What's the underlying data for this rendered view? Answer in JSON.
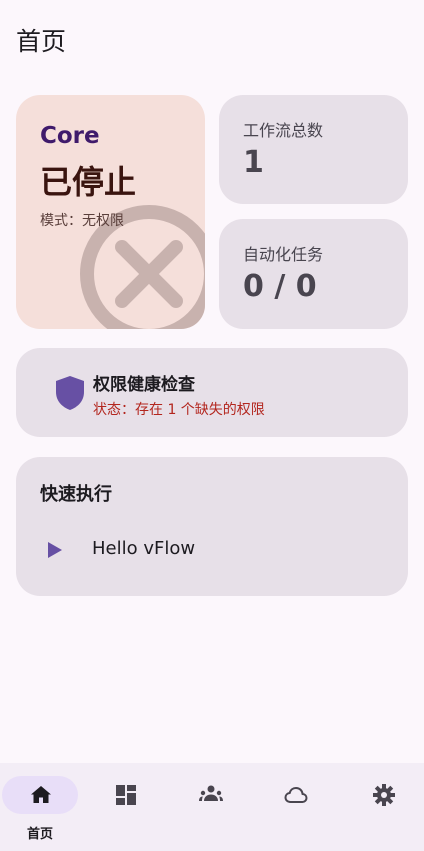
{
  "header": {
    "title": "首页"
  },
  "core": {
    "label": "Core",
    "status": "已停止",
    "mode": "模式：无权限"
  },
  "stats": {
    "workflow_label": "工作流总数",
    "workflow_value": "1",
    "tasks_label": "自动化任务",
    "tasks_value": "0 / 0"
  },
  "health": {
    "title": "权限健康检查",
    "status": "状态：存在 1 个缺失的权限"
  },
  "quick_run": {
    "title": "快速执行",
    "items": [
      {
        "label": "Hello vFlow",
        "icon": "play-icon"
      }
    ]
  },
  "bottom_nav": {
    "items": [
      {
        "label": "首页",
        "icon": "home-icon",
        "active": true
      },
      {
        "label": "",
        "icon": "dashboard-icon",
        "active": false
      },
      {
        "label": "",
        "icon": "community-icon",
        "active": false
      },
      {
        "label": "",
        "icon": "cloud-icon",
        "active": false
      },
      {
        "label": "",
        "icon": "settings-icon",
        "active": false
      }
    ]
  },
  "colors": {
    "background": "#fcf7fc",
    "core_card": "#f5dfda",
    "stat_card": "#e7e0e8",
    "accent": "#6750a4",
    "error": "#b3261e"
  }
}
